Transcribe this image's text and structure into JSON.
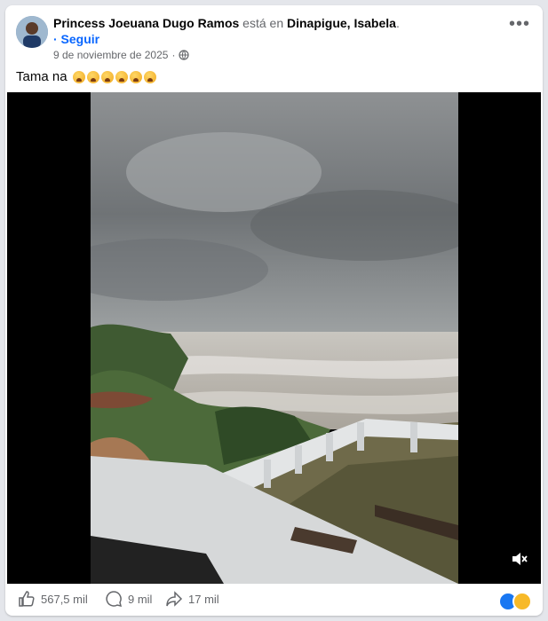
{
  "post": {
    "author": "Princess Joeuana Dugo Ramos",
    "connector": " está en ",
    "location": "Dinapigue, Isabela",
    "location_suffix": ".",
    "follow_label": "· Seguir",
    "date": "9 de noviembre de 2025",
    "date_sep": "·",
    "caption": "Tama na",
    "caption_emoji_count": 6,
    "more_label": "•••"
  },
  "stats": {
    "likes": "567,5 mil",
    "comments": "9 mil",
    "shares": "17 mil"
  },
  "icons": {
    "privacy": "globe-icon",
    "like": "thumbs-up-icon",
    "comment": "comment-icon",
    "share": "share-icon",
    "mute": "muted-speaker-icon"
  },
  "colors": {
    "accent": "#0866ff",
    "muted_text": "#65676b"
  }
}
